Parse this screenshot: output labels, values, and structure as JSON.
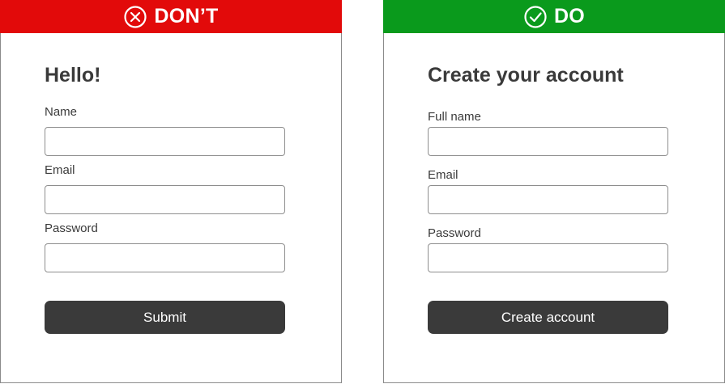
{
  "dont_panel": {
    "banner_label": "DON’T",
    "banner_icon": "x-circle-icon",
    "banner_color": "#e20a0a",
    "heading": "Hello!",
    "fields": [
      {
        "label": "Name"
      },
      {
        "label": "Email"
      },
      {
        "label": "Password"
      }
    ],
    "button_label": "Submit"
  },
  "do_panel": {
    "banner_label": "DO",
    "banner_icon": "check-circle-icon",
    "banner_color": "#0a9a1c",
    "heading": "Create your account",
    "fields": [
      {
        "label": "Full name"
      },
      {
        "label": "Email"
      },
      {
        "label": "Password"
      }
    ],
    "button_label": "Create account"
  },
  "colors": {
    "button_bg": "#3a3a3a",
    "text": "#3a3a3a",
    "field_border": "#8e8e8e"
  }
}
